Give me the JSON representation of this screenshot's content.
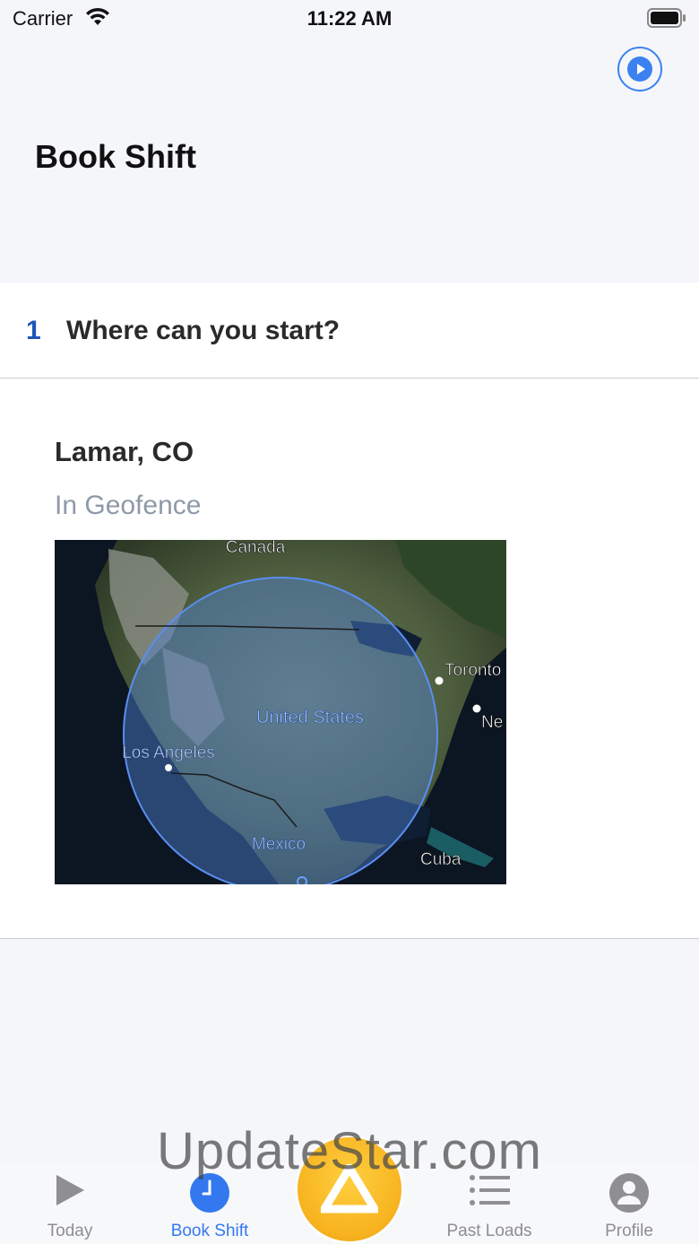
{
  "status_bar": {
    "carrier": "Carrier",
    "time": "11:22 AM"
  },
  "header": {
    "title": "Book Shift",
    "play_icon": "play-circle-icon"
  },
  "step": {
    "number": "1",
    "title": "Where can you start?"
  },
  "location": {
    "name": "Lamar, CO",
    "status": "In Geofence"
  },
  "map": {
    "labels": {
      "canada": "Canada",
      "united_states": "United States",
      "los_angeles": "Los Angeles",
      "mexico": "Mexico",
      "toronto": "Toronto",
      "new_york": "Ne",
      "cuba": "Cuba"
    }
  },
  "tabs": [
    {
      "label": "Today",
      "icon": "play-icon",
      "active": false
    },
    {
      "label": "Book Shift",
      "icon": "clock-icon",
      "active": true
    },
    {
      "label": "Past Loads",
      "icon": "list-icon",
      "active": false
    },
    {
      "label": "Profile",
      "icon": "person-icon",
      "active": false
    }
  ],
  "center_button": {
    "icon": "triangle-logo-icon"
  },
  "watermark": "UpdateStar.com",
  "colors": {
    "accent": "#3478f0",
    "step_number": "#1e56b5",
    "fab": "#f7b21f",
    "muted": "#8e99a8"
  }
}
